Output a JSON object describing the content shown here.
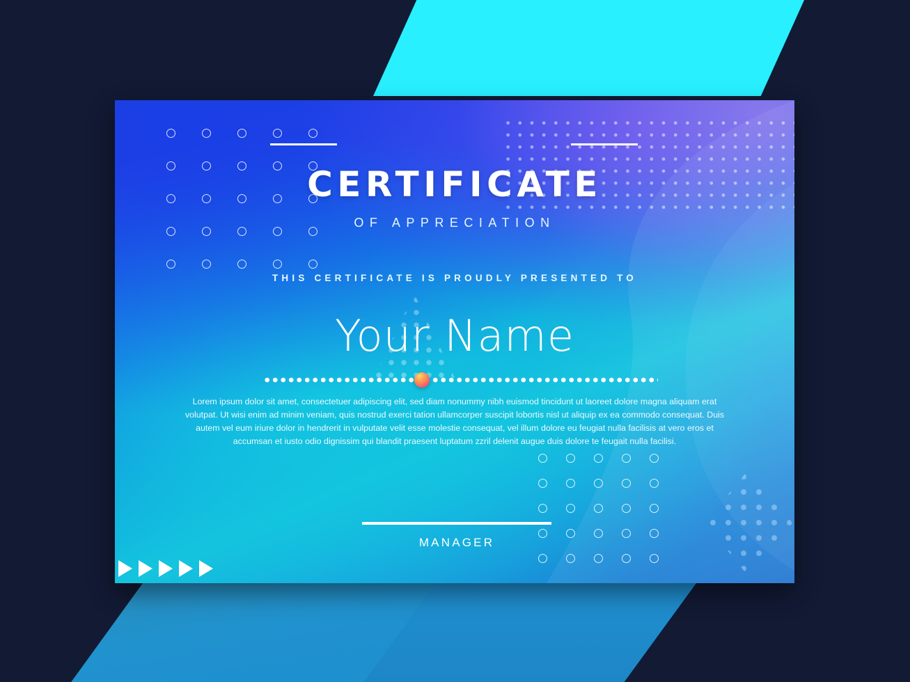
{
  "document": {
    "type": "certificate-template",
    "title": "CERTIFICATE",
    "subtitle": "OF APPRECIATION",
    "presented_to_label": "THIS CERTIFICATE IS PROUDLY PRESENTED TO",
    "recipient_name": "Your Name",
    "body_text": "Lorem ipsum dolor sit amet, consectetuer adipiscing elit, sed diam nonummy nibh euismod tincidunt ut laoreet dolore magna aliquam erat volutpat. Ut wisi enim ad minim veniam, quis nostrud exerci tation ullamcorper suscipit lobortis nisl ut aliquip ex ea commodo consequat. Duis autem vel eum iriure dolor in hendrerit in vulputate velit esse molestie consequat, vel illum dolore eu feugiat nulla facilisis at vero eros et accumsan et iusto odio dignissim qui blandit praesent luptatum zzril delenit augue duis dolore te feugait nulla facilisi.",
    "signature_role": "MANAGER"
  },
  "decorations": {
    "ring_grid_topleft": "5x5-ring-grid",
    "ring_grid_bottomright": "5x5-ring-grid",
    "halftone_topright": "dot-halftone-pattern",
    "dot_triangle": "triangle-dot-cluster",
    "dot_diamond": "diamond-dot-cluster",
    "arrow_count": 5,
    "arrow_glyph": "play-triangle"
  },
  "colors": {
    "background": "#121a34",
    "top_band": "#28f0ff",
    "bottom_band": "#1f8fd0",
    "card_blue": "#1464e8",
    "card_violet": "#2a35d8",
    "card_cyan": "#14c4dd",
    "accent_ball": "#f6556e",
    "text_white": "#ffffff"
  }
}
